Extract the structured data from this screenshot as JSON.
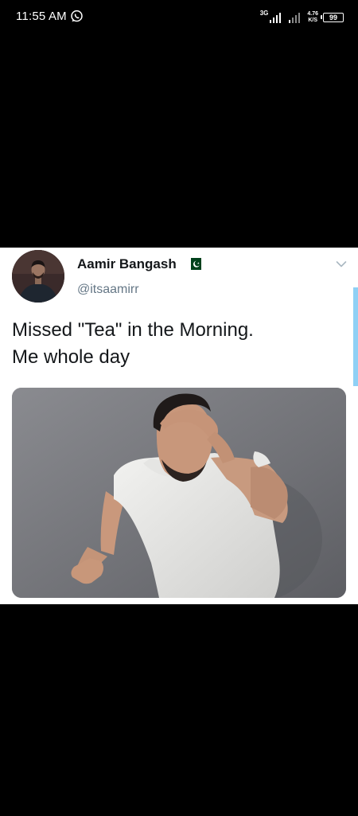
{
  "status_bar": {
    "time": "11:55 AM",
    "network": "3G",
    "speed_value": "4.76",
    "speed_unit": "K/S",
    "battery": "99",
    "notification_icon": "whatsapp-icon"
  },
  "tweet": {
    "display_name": "Aamir Bangash",
    "handle": "@itsaamirr",
    "flag": "pakistan-flag-icon",
    "text_lines": [
      "Missed \"Tea\" in the Morning.",
      "Me whole day"
    ]
  },
  "colors": {
    "text_primary": "#14171a",
    "text_secondary": "#657786",
    "scroll_indicator": "#8fd0f5",
    "flag_green": "#01411c"
  }
}
